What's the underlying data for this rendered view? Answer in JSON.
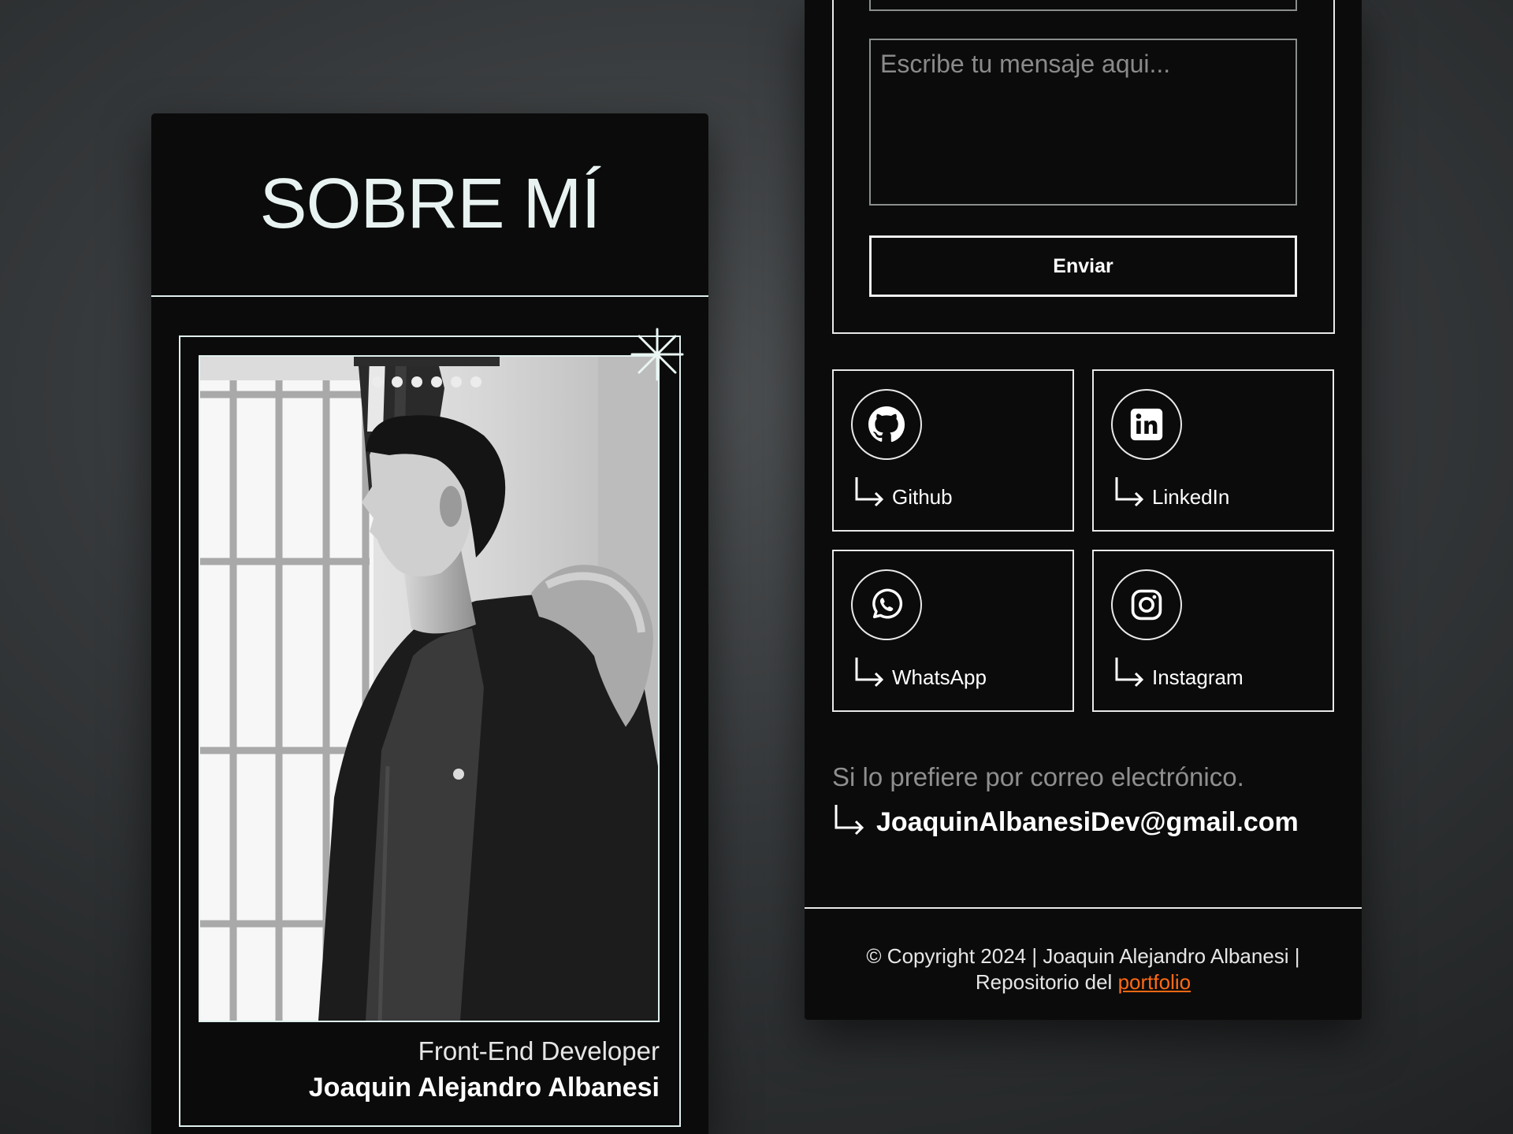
{
  "about": {
    "title": "SOBRE MÍ",
    "role": "Front-End Developer",
    "name": "Joaquin Alejandro Albanesi"
  },
  "contact_form": {
    "message_placeholder": "Escribe tu mensaje aqui...",
    "submit_label": "Enviar"
  },
  "socials": [
    {
      "label": "Github",
      "icon": "github-icon"
    },
    {
      "label": "LinkedIn",
      "icon": "linkedin-icon"
    },
    {
      "label": "WhatsApp",
      "icon": "whatsapp-icon"
    },
    {
      "label": "Instagram",
      "icon": "instagram-icon"
    }
  ],
  "email": {
    "hint": "Si lo prefiere por correo electrónico.",
    "address": "JoaquinAlbanesiDev@gmail.com"
  },
  "footer": {
    "copyright": "© Copyright 2024 | Joaquin Alejandro Albanesi |",
    "repo_prefix": "Repositorio del",
    "repo_link": "portfolio"
  },
  "colors": {
    "background": "#3a3d3f",
    "card": "#0b0b0b",
    "accent_border": "#dff0ee",
    "link": "#ff6a13"
  }
}
